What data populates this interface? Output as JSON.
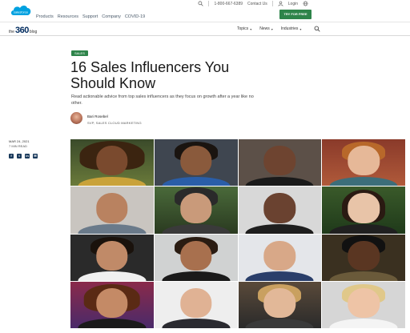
{
  "brand": {
    "logo_text": "salesforce"
  },
  "topnav": [
    "Products",
    "Resources",
    "Support",
    "Company",
    "COVID-19"
  ],
  "utility": {
    "phone": "1-800-667-6389",
    "contact": "Contact Us",
    "login": "Login"
  },
  "cta": {
    "label": "TRY FOR FREE"
  },
  "blog": {
    "the": "the",
    "num": "360",
    "blog": "blog"
  },
  "subnav": [
    "Topics",
    "News",
    "Industries"
  ],
  "article": {
    "tag": "SALES",
    "title": "16 Sales Influencers You Should Know",
    "dek": "Read actionable advice from top sales influencers as they focus on growth after a year like no other.",
    "author_name": "Bari Rosebel",
    "author_title": "SVP, SALES CLOUD MARKETING",
    "date": "MAR 24, 2021",
    "read_time": "7 MIN READ"
  },
  "share_icons": [
    "facebook-icon",
    "twitter-icon",
    "linkedin-icon",
    "email-icon"
  ],
  "colors": {
    "accent_green": "#2e844a",
    "brand_blue": "#00a1e0",
    "navy": "#032d60"
  }
}
